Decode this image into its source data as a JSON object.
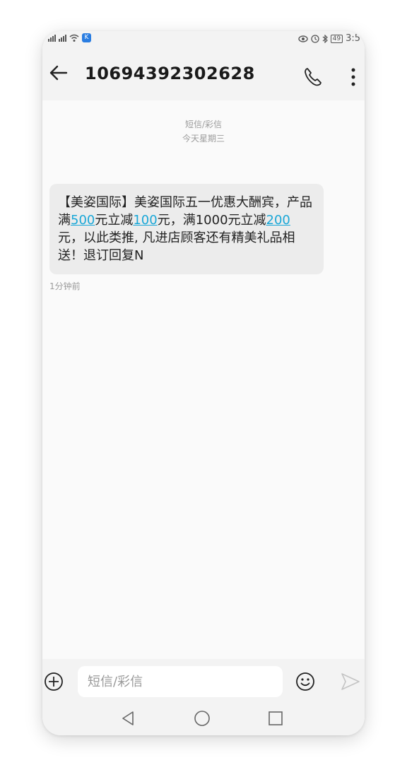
{
  "status_bar": {
    "vpn_badge": "K",
    "battery": "49",
    "time": "3:5"
  },
  "header": {
    "contact": "10694392302628",
    "back_icon": "back-arrow-icon",
    "call_icon": "phone-icon",
    "more_icon": "more-vertical-icon"
  },
  "conversation": {
    "message_type": "短信/彩信",
    "date": "今天星期三",
    "message": {
      "parts": [
        {
          "text": "【美姿国际】美姿国际五一优惠大酬宾，产品满",
          "link": false
        },
        {
          "text": "500",
          "link": true
        },
        {
          "text": "元立减",
          "link": false
        },
        {
          "text": "100",
          "link": true
        },
        {
          "text": "元，满1000元立减",
          "link": false
        },
        {
          "text": "200",
          "link": true
        },
        {
          "text": "元，以此类推, 凡进店顾客还有精美礼品相送！退订回复N",
          "link": false
        }
      ],
      "time": "1分钟前"
    }
  },
  "input_bar": {
    "placeholder": "短信/彩信",
    "add_icon": "plus-circle-icon",
    "emoji_icon": "smiley-icon",
    "send_icon": "send-icon"
  },
  "nav_bar": {
    "back_icon": "nav-back-triangle-icon",
    "home_icon": "nav-home-circle-icon",
    "recent_icon": "nav-recent-square-icon"
  },
  "colors": {
    "accent": "#1aa7d7",
    "bubble": "#ececec",
    "bar": "#f3f3f3",
    "background": "#fafafa"
  }
}
